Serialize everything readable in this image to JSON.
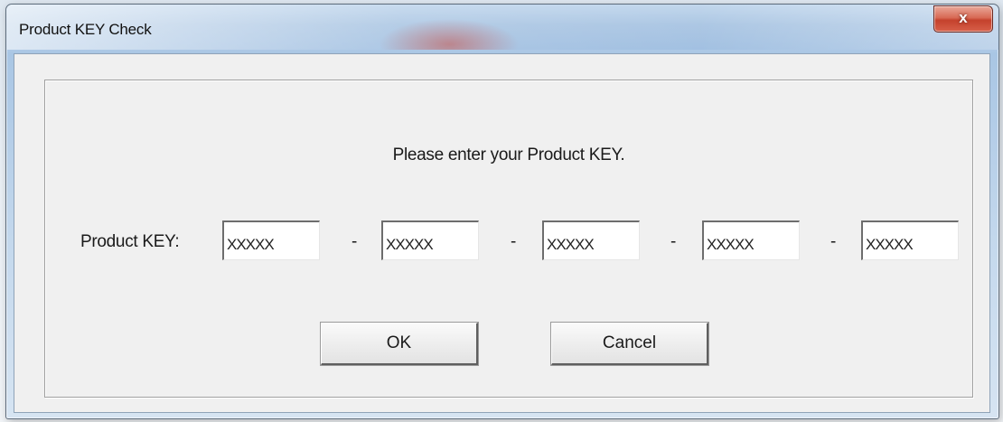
{
  "window": {
    "title": "Product KEY Check",
    "close_label": "x"
  },
  "dialog": {
    "prompt": "Please enter your Product KEY.",
    "key_label": "Product KEY:",
    "separator": "-",
    "key_fields": [
      {
        "value": "XXXXX"
      },
      {
        "value": "XXXXX"
      },
      {
        "value": "XXXXX"
      },
      {
        "value": "XXXXX"
      },
      {
        "value": "XXXXX"
      }
    ],
    "ok_label": "OK",
    "cancel_label": "Cancel"
  },
  "colors": {
    "dialog_background": "#f0f0f0",
    "close_button": "#c94a36",
    "title_bar": "#a8c4e2"
  }
}
